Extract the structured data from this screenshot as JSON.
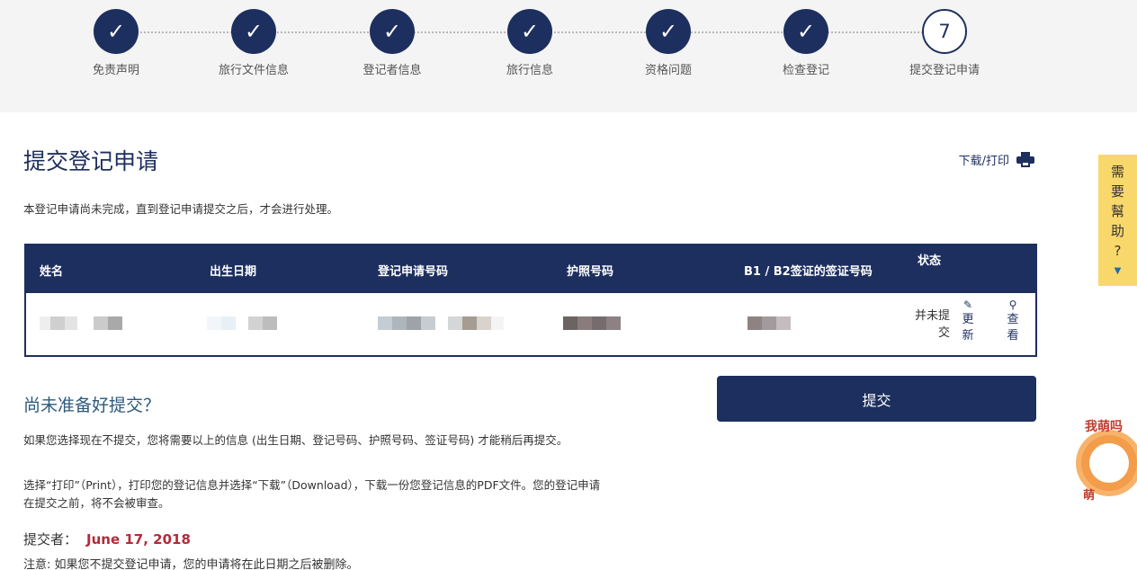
{
  "stepper": {
    "steps": [
      {
        "label": "免责声明",
        "marker": "✓",
        "done": true
      },
      {
        "label": "旅行文件信息",
        "marker": "✓",
        "done": true
      },
      {
        "label": "登记者信息",
        "marker": "✓",
        "done": true
      },
      {
        "label": "旅行信息",
        "marker": "✓",
        "done": true
      },
      {
        "label": "资格问题",
        "marker": "✓",
        "done": true
      },
      {
        "label": "检查登记",
        "marker": "✓",
        "done": true
      },
      {
        "label": "提交登记申请",
        "marker": "7",
        "done": false
      }
    ]
  },
  "page": {
    "title": "提交登记申请",
    "print_label": "下载/打印",
    "notice": "本登记申请尚未完成，直到登记申请提交之后，才会进行处理。"
  },
  "table": {
    "headers": {
      "name": "姓名",
      "dob": "出生日期",
      "app_number": "登记申请号码",
      "passport": "护照号码",
      "visa": "B1 / B2签证的签证号码",
      "status": "状态"
    },
    "row": {
      "status": "并未提交",
      "update_label": "更新",
      "view_label": "查看"
    }
  },
  "submit_button": "提交",
  "not_ready": {
    "heading": "尚未准备好提交？",
    "para1": "如果您选择现在不提交，您将需要以上的信息 (出生日期、登记号码、护照号码、签证号码) 才能稍后再提交。",
    "para2": "选择“打印”（Print），打印您的登记信息并选择“下载”（Download），下载一份您登记信息的PDF文件。您的登记申请在提交之前，将不会被审查。"
  },
  "submitted": {
    "label": "提交者：",
    "date": "June 17, 2018"
  },
  "note": "注意: 如果您不提交登记申请，您的申请将在此日期之后被删除。",
  "help_tab": {
    "chars": [
      "需",
      "要",
      "幫",
      "助",
      "?"
    ],
    "arrow": "▼"
  },
  "sticker": {
    "top_text": "我萌吗",
    "bottom_text": "萌"
  },
  "icons": {
    "printer": "printer-icon",
    "pencil": "pencil-icon",
    "search": "search-icon",
    "check": "check-icon"
  },
  "colors": {
    "navy": "#1d2f5e",
    "heading_teal": "#2c5a7c",
    "date_red": "#b5293a",
    "help_yellow": "#f9d86b"
  }
}
